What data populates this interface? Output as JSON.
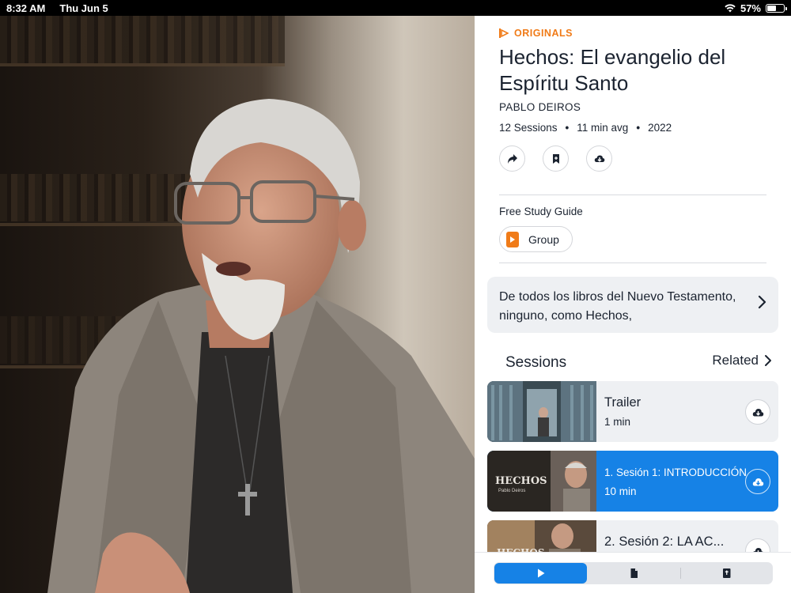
{
  "status_bar": {
    "time": "8:32 AM",
    "date": "Thu Jun 5",
    "battery": "57%",
    "battery_level": 0.57
  },
  "series": {
    "badge": "ORIGINALS",
    "title": "Hechos: El evangelio del Espíritu Santo",
    "author": "PABLO DEIROS",
    "sessions_count": "12 Sessions",
    "avg_length": "11 min avg",
    "year": "2022",
    "meta_separator": "•"
  },
  "actions": [
    {
      "name": "share-button",
      "icon": "share-icon"
    },
    {
      "name": "bookmark-button",
      "icon": "bookmark-icon"
    },
    {
      "name": "download-button",
      "icon": "cloud-download-icon"
    }
  ],
  "study_guide": {
    "label": "Free Study Guide",
    "button_label": "Group"
  },
  "description": "De todos los libros del Nuevo Testamento, ninguno, como Hechos,",
  "sessions_header": {
    "title": "Sessions",
    "related_label": "Related"
  },
  "sessions": [
    {
      "title": "Trailer",
      "duration": "1 min",
      "active": false
    },
    {
      "title": "1. Sesión 1: INTRODUCCIÓN",
      "duration": "10 min",
      "active": true,
      "thumb_title": "HECHOS",
      "thumb_subtitle": "Pablo Deiros"
    },
    {
      "title": "2. Sesión 2: LA AC...",
      "duration": "",
      "active": false,
      "thumb_title": "HECHOS"
    }
  ],
  "bottom_tabs": [
    {
      "name": "tab-play",
      "icon": "play-icon",
      "active": true
    },
    {
      "name": "tab-notes",
      "icon": "document-icon",
      "active": false
    },
    {
      "name": "tab-bible",
      "icon": "bible-icon",
      "active": false
    }
  ],
  "colors": {
    "accent": "#1682e6",
    "brand": "#f07b18",
    "text": "#1b2330"
  }
}
